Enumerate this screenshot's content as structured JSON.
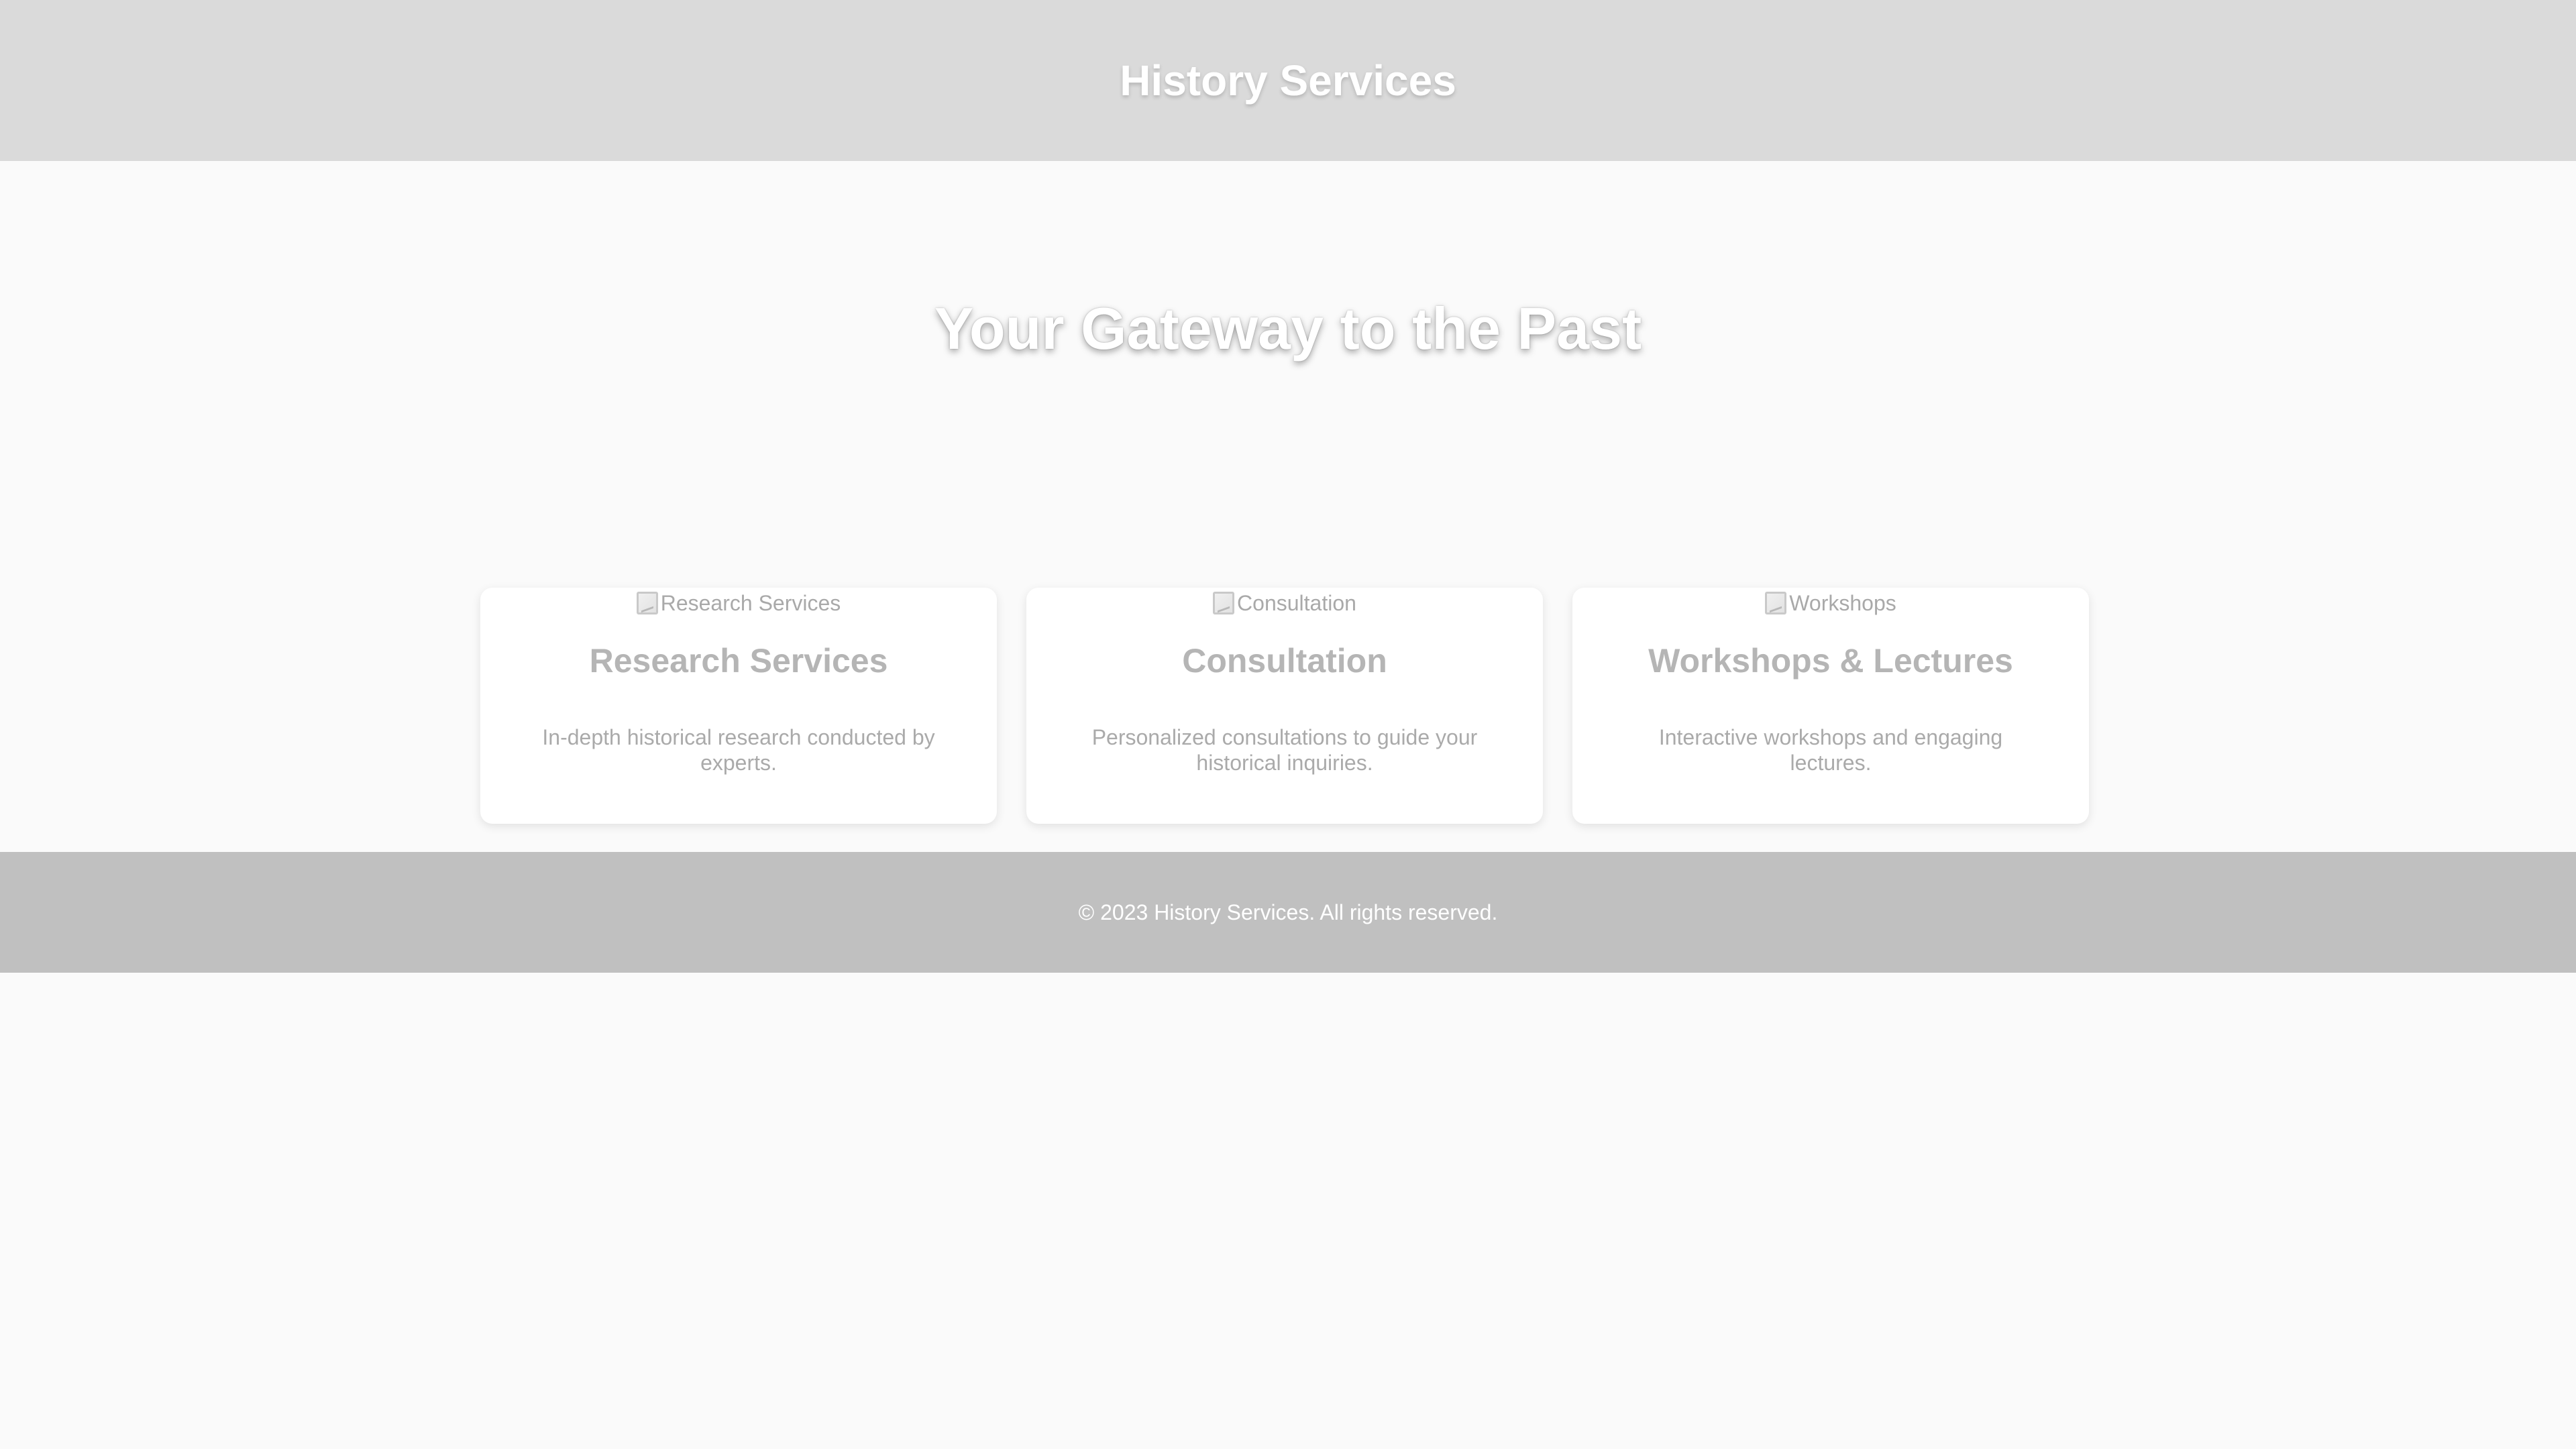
{
  "header": {
    "title": "History Services"
  },
  "hero": {
    "headline": "Your Gateway to the Past"
  },
  "services": [
    {
      "image_alt": "Research Services",
      "title": "Research Services",
      "description": "In-depth historical research conducted by experts."
    },
    {
      "image_alt": "Consultation",
      "title": "Consultation",
      "description": "Personalized consultations to guide your historical inquiries."
    },
    {
      "image_alt": "Workshops",
      "title": "Workshops & Lectures",
      "description": "Interactive workshops and engaging lectures."
    }
  ],
  "footer": {
    "copyright": "© 2023 History Services. All rights reserved."
  },
  "colors": {
    "header_bg": "#dadada",
    "page_bg": "#fafafa",
    "footer_bg": "#c0c0c0",
    "card_bg": "#ffffff"
  },
  "icons": {
    "broken_image": "broken-image-icon"
  }
}
